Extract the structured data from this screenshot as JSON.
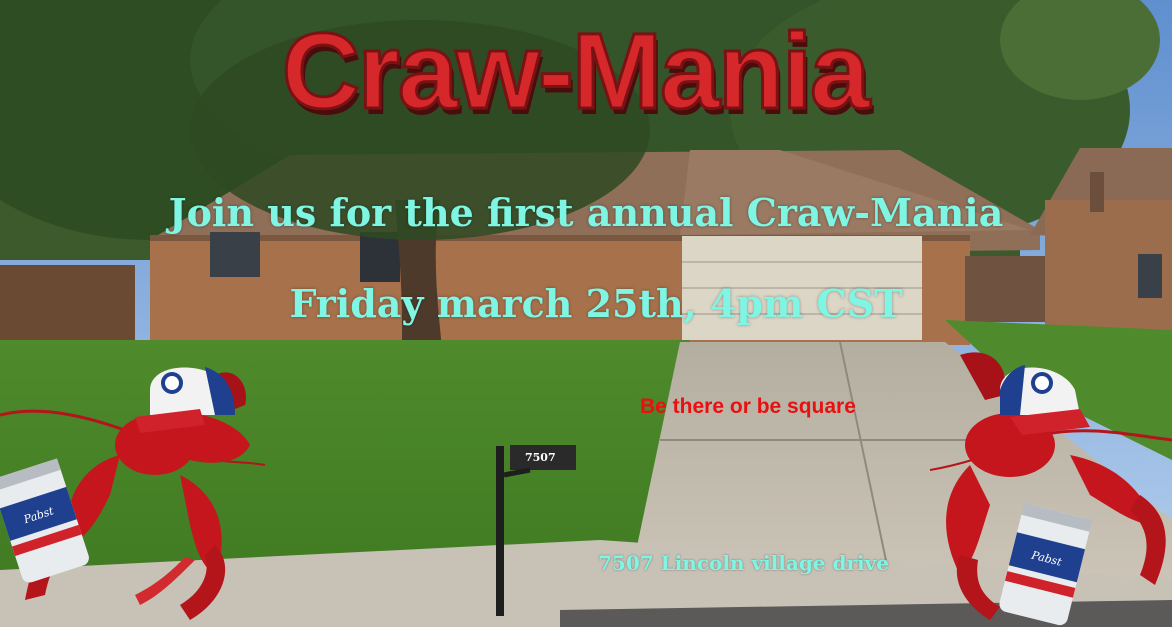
{
  "title": "Craw-Mania",
  "invite_line": "Join us for the first annual Craw-Mania",
  "date_line": "Friday march 25th, 4pm CST",
  "tagline": "Be there or be square",
  "address": "7507 Lincoln village drive",
  "mailbox_number": "7507",
  "colors": {
    "title_red": "#d6282a",
    "cyan_text": "#7ff5e4",
    "tagline_red": "#e81010",
    "crawfish_red": "#c4161c"
  },
  "stickers": [
    {
      "name": "crawfish-with-cap-and-beer",
      "position": "bottom-left"
    },
    {
      "name": "crawfish-with-cap-and-beer",
      "position": "bottom-right"
    }
  ],
  "can_label": "Pabst Blue Ribbon"
}
